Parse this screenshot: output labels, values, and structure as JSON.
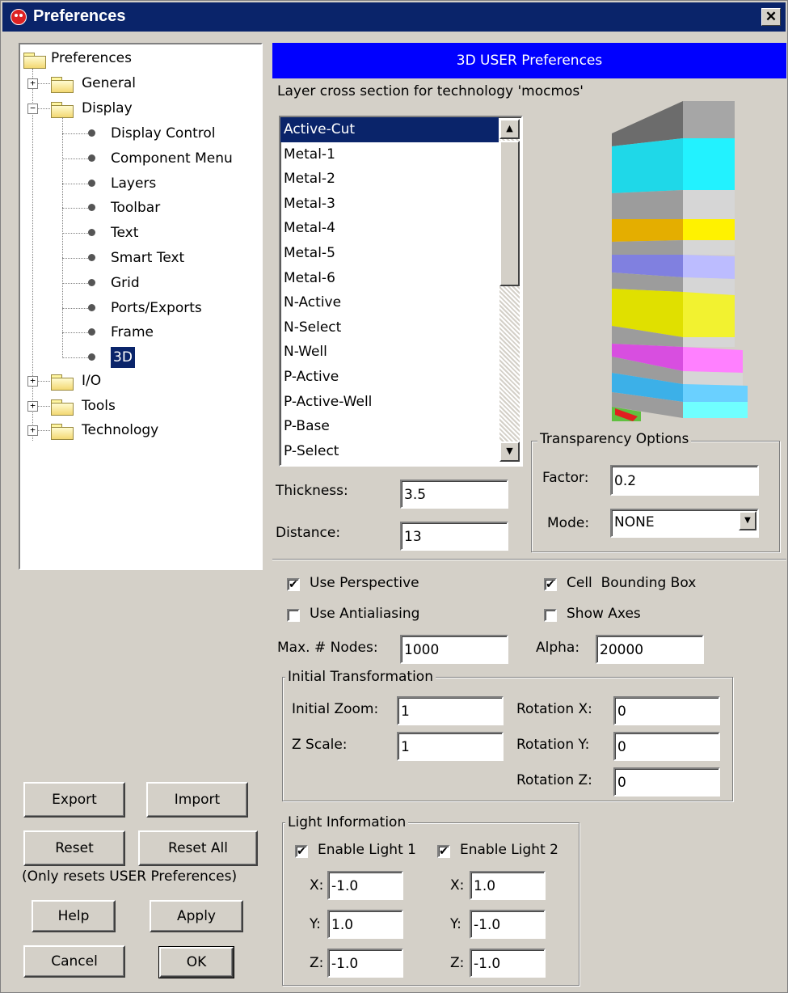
{
  "window": {
    "title": "Preferences",
    "close_label": "✕"
  },
  "tree": {
    "root": "Preferences",
    "general": "General",
    "display": "Display",
    "display_children": [
      "Display Control",
      "Component Menu",
      "Layers",
      "Toolbar",
      "Text",
      "Smart Text",
      "Grid",
      "Ports/Exports",
      "Frame",
      "3D"
    ],
    "io": "I/O",
    "tools": "Tools",
    "technology": "Technology",
    "selected": "3D"
  },
  "buttons": {
    "export": "Export",
    "import": "Import",
    "reset": "Reset",
    "reset_all": "Reset All",
    "reset_note": "(Only resets USER Preferences)",
    "help": "Help",
    "apply": "Apply",
    "cancel": "Cancel",
    "ok": "OK"
  },
  "panel": {
    "header": "3D USER Preferences",
    "cross_section_label": "Layer cross section for technology 'mocmos'",
    "layers": [
      "Active-Cut",
      "Metal-1",
      "Metal-2",
      "Metal-3",
      "Metal-4",
      "Metal-5",
      "Metal-6",
      "N-Active",
      "N-Select",
      "N-Well",
      "P-Active",
      "P-Active-Well",
      "P-Base",
      "P-Select"
    ],
    "selected_layer": "Active-Cut",
    "thickness_label": "Thickness:",
    "thickness_value": "3.5",
    "distance_label": "Distance:",
    "distance_value": "13",
    "transparency": {
      "title": "Transparency Options",
      "factor_label": "Factor:",
      "factor_value": "0.2",
      "mode_label": "Mode:",
      "mode_value": "NONE"
    },
    "use_perspective": {
      "label": "Use Perspective",
      "checked": true
    },
    "cell_bbox": {
      "label": "Cell  Bounding Box",
      "checked": true
    },
    "use_antialiasing": {
      "label": "Use Antialiasing",
      "checked": false
    },
    "show_axes": {
      "label": "Show Axes",
      "checked": false
    },
    "max_nodes_label": "Max. # Nodes:",
    "max_nodes_value": "1000",
    "alpha_label": "Alpha:",
    "alpha_value": "20000",
    "initial_transformation": {
      "title": "Initial Transformation",
      "zoom_label": "Initial Zoom:",
      "zoom_value": "1",
      "zscale_label": "Z Scale:",
      "zscale_value": "1",
      "rotx_label": "Rotation X:",
      "rotx_value": "0",
      "roty_label": "Rotation Y:",
      "roty_value": "0",
      "rotz_label": "Rotation Z:",
      "rotz_value": "0"
    },
    "light": {
      "title": "Light Information",
      "light1_label": "Enable Light 1",
      "light1_checked": true,
      "light2_label": "Enable Light 2",
      "light2_checked": true,
      "x_label": "X:",
      "y_label": "Y:",
      "z_label": "Z:",
      "l1_x": "-1.0",
      "l1_y": "1.0",
      "l1_z": "-1.0",
      "l2_x": "1.0",
      "l2_y": "-1.0",
      "l2_z": "-1.0"
    }
  },
  "colors": {
    "title_bar": "#0a246a",
    "header": "#0000ff",
    "selection": "#0a246a",
    "face": "#d4d0c8"
  }
}
